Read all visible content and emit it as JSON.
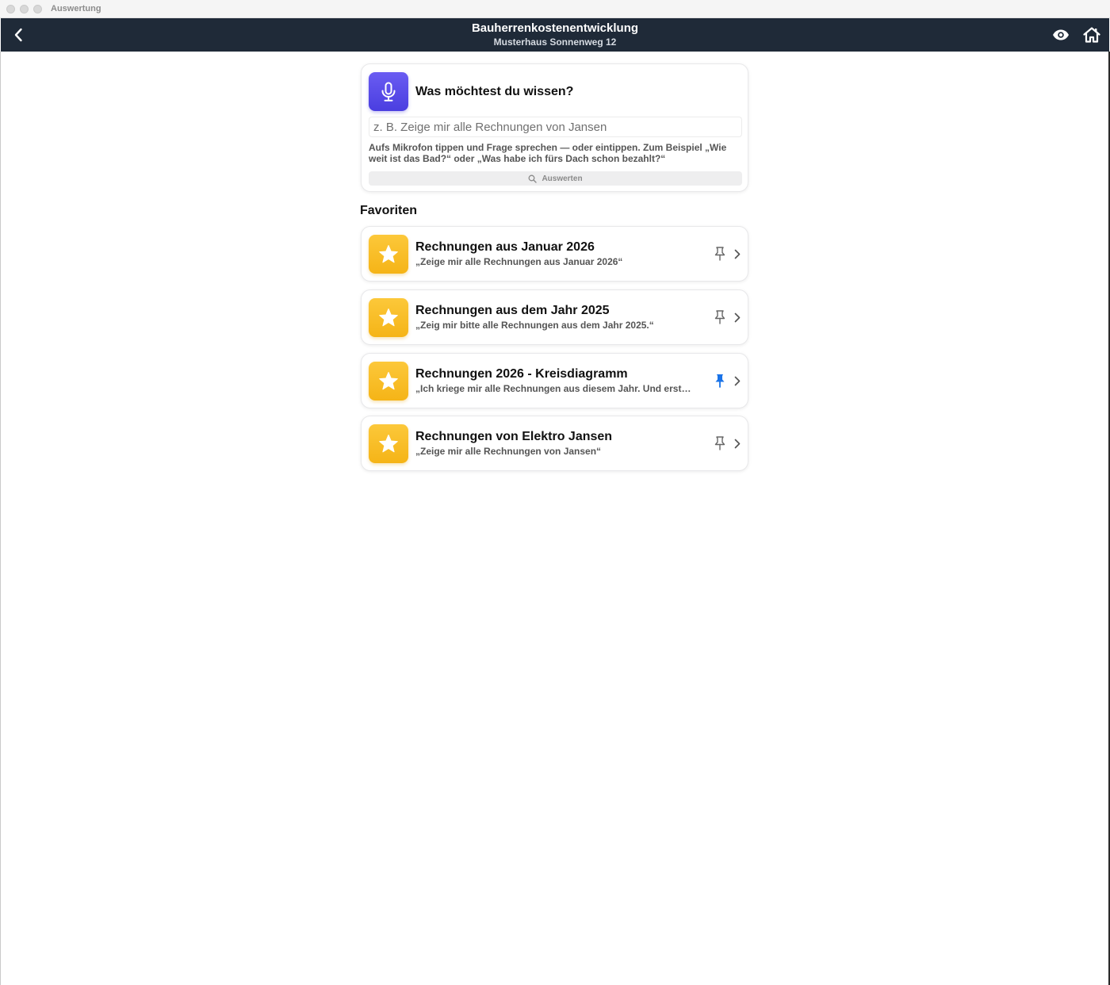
{
  "window": {
    "title": "Auswertung"
  },
  "header": {
    "title": "Bauherrenkostenentwicklung",
    "subtitle": "Musterhaus Sonnenweg 12"
  },
  "ask": {
    "title": "Was möchtest du wissen?",
    "placeholder": "z. B. Zeige mir alle Rechnungen von Jansen",
    "hint": "Aufs Mikrofon tippen und Frage sprechen — oder eintippen. Zum Beispiel „Wie weit ist das Bad?“ oder „Was habe ich fürs Dach schon bezahlt?“",
    "button_label": "Auswerten"
  },
  "favorites": {
    "title": "Favoriten",
    "items": [
      {
        "title": "Rechnungen aus Januar 2026",
        "query": "„Zeige mir alle Rechnungen aus Januar 2026“",
        "pinned": false
      },
      {
        "title": "Rechnungen aus dem Jahr 2025",
        "query": "„Zeig mir bitte alle Rechnungen aus dem Jahr 2025.“",
        "pinned": false
      },
      {
        "title": "Rechnungen 2026 - Kreisdiagramm",
        "query": "„Ich kriege mir alle Rechnungen aus diesem Jahr. Und erstell...",
        "pinned": true
      },
      {
        "title": "Rechnungen von Elektro Jansen",
        "query": "„Zeige mir alle Rechnungen von Jansen“",
        "pinned": false
      }
    ]
  },
  "colors": {
    "navbar": "#1f2a38",
    "mic_accent": "#5347e8",
    "star_accent": "#f7bb22",
    "pin_active": "#1a73e8",
    "pin_inactive": "#666666"
  },
  "icons": {
    "back": "chevron-left-icon",
    "eye": "eye-icon",
    "home": "home-icon",
    "mic": "microphone-icon",
    "search": "search-icon",
    "star": "star-icon",
    "pin": "pin-icon",
    "chevron": "chevron-right-icon"
  }
}
